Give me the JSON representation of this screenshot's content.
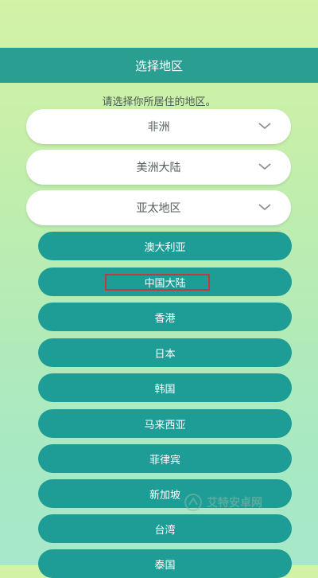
{
  "header": {
    "title": "选择地区"
  },
  "prompt": "请选择你所居住的地区。",
  "regions": [
    {
      "label": "非洲"
    },
    {
      "label": "美洲大陆"
    },
    {
      "label": "亚太地区"
    }
  ],
  "countries": [
    {
      "label": "澳大利亚"
    },
    {
      "label": "中国大陆"
    },
    {
      "label": "香港"
    },
    {
      "label": "日本"
    },
    {
      "label": "韩国"
    },
    {
      "label": "马来西亚"
    },
    {
      "label": "菲律宾"
    },
    {
      "label": "新加坡"
    },
    {
      "label": "台湾"
    },
    {
      "label": "泰国"
    }
  ],
  "watermark": {
    "text": "艾特安卓网"
  },
  "colors": {
    "header": "#2b9e92",
    "country_button": "#1e9d96",
    "highlight_box": "#c0393b"
  }
}
